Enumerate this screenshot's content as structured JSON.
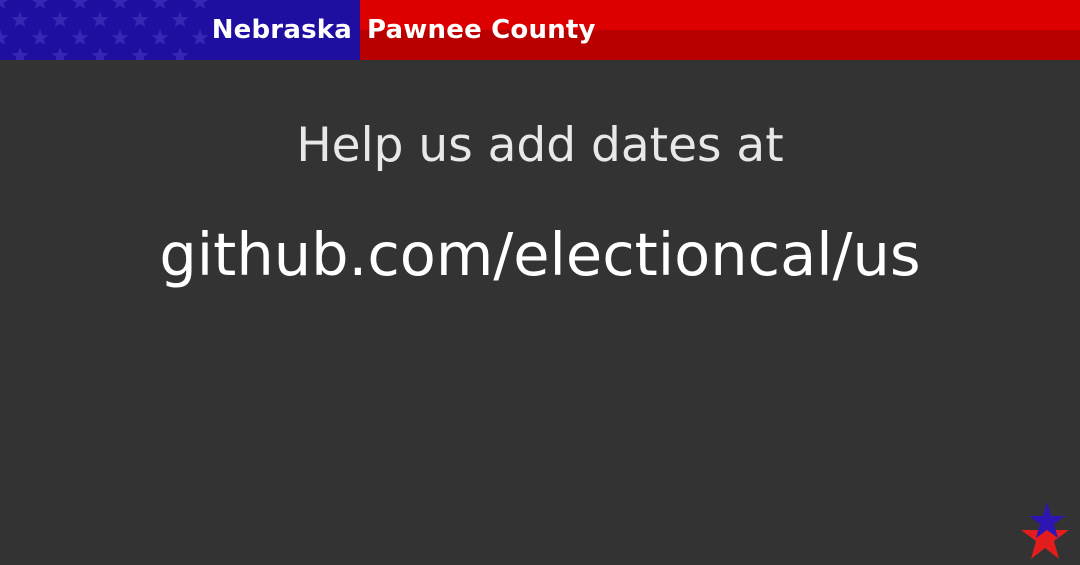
{
  "header": {
    "state": "Nebraska",
    "county": "Pawnee County"
  },
  "main": {
    "help_text": "Help us add dates at",
    "url": "github.com/electioncal/us"
  },
  "colors": {
    "background": "#333333",
    "banner_blue": "#1e0fa0",
    "banner_red": "#dd0000",
    "banner_red_dark": "#b90000",
    "text": "#ffffff"
  },
  "icons": {
    "banner_pattern": "star-pattern-icon",
    "logo": "star-logo-icon"
  }
}
